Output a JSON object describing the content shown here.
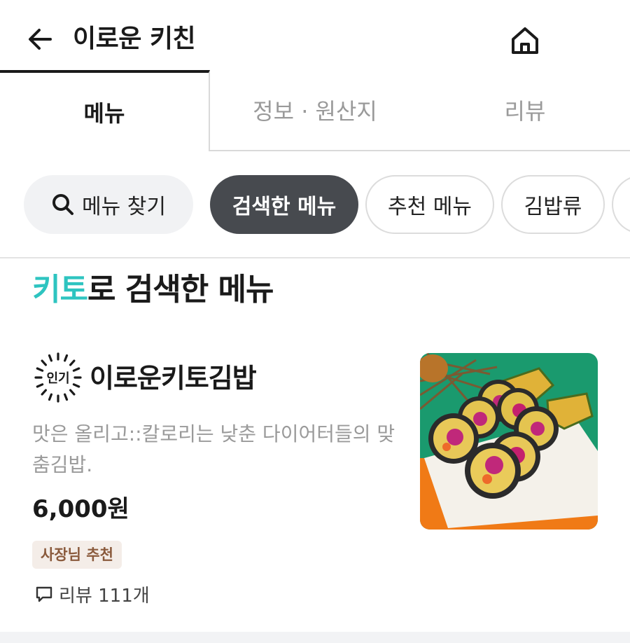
{
  "header": {
    "title": "이로운 키친",
    "back_icon": "arrow-left-icon",
    "home_icon": "home-icon"
  },
  "tabs": [
    {
      "label": "메뉴",
      "active": true
    },
    {
      "label": "정보 · 원산지",
      "active": false
    },
    {
      "label": "리뷰",
      "active": false
    }
  ],
  "chips": {
    "search_label": "메뉴 찾기",
    "items": [
      "검색한 메뉴",
      "추천 메뉴",
      "김밥류"
    ]
  },
  "section": {
    "keyword": "키토",
    "title_suffix": "로 검색한 메뉴"
  },
  "menu_item": {
    "badge": "인기",
    "name": "이로운키토김밥",
    "description": "맛은 올리고::칼로리는 낮춘 다이어터들의 맞춤김밥.",
    "price": "6,000원",
    "owner_badge": "사장님 추천",
    "review_label": "리뷰 111개"
  },
  "colors": {
    "accent": "#2ec4c0",
    "chip_active": "#474a4f",
    "owner_badge_bg": "#f4ede8",
    "owner_badge_text": "#8a5a3c"
  }
}
